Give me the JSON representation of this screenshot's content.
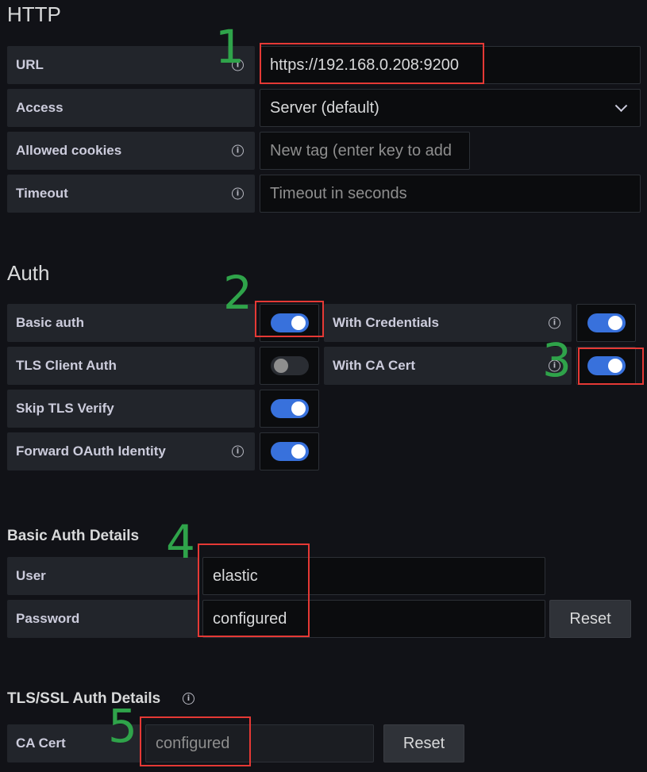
{
  "http": {
    "title": "HTTP",
    "url": {
      "label": "URL",
      "value": "https://192.168.0.208:9200"
    },
    "access": {
      "label": "Access",
      "value": "Server (default)"
    },
    "allowed_cookies": {
      "label": "Allowed cookies",
      "placeholder": "New tag (enter key to add"
    },
    "timeout": {
      "label": "Timeout",
      "placeholder": "Timeout in seconds"
    }
  },
  "auth": {
    "title": "Auth",
    "basic_auth": {
      "label": "Basic auth",
      "enabled": true
    },
    "with_credentials": {
      "label": "With Credentials",
      "enabled": true
    },
    "tls_client_auth": {
      "label": "TLS Client Auth",
      "enabled": false
    },
    "with_ca_cert": {
      "label": "With CA Cert",
      "enabled": true
    },
    "skip_tls_verify": {
      "label": "Skip TLS Verify",
      "enabled": true
    },
    "forward_oauth": {
      "label": "Forward OAuth Identity",
      "enabled": true
    }
  },
  "basic_auth_details": {
    "title": "Basic Auth Details",
    "user": {
      "label": "User",
      "value": "elastic"
    },
    "password": {
      "label": "Password",
      "value": "configured"
    },
    "reset_label": "Reset"
  },
  "tls_details": {
    "title": "TLS/SSL Auth Details",
    "ca_cert": {
      "label": "CA Cert",
      "value": "configured"
    },
    "reset_label": "Reset"
  },
  "annotations": [
    "1",
    "2",
    "3",
    "4",
    "5"
  ],
  "icons": {
    "info": "info-icon",
    "chevron": "chevron-down-icon"
  },
  "colors": {
    "accent": "#3871dc",
    "annotation_box": "#e53935",
    "annotation_number": "#2fa34a"
  }
}
